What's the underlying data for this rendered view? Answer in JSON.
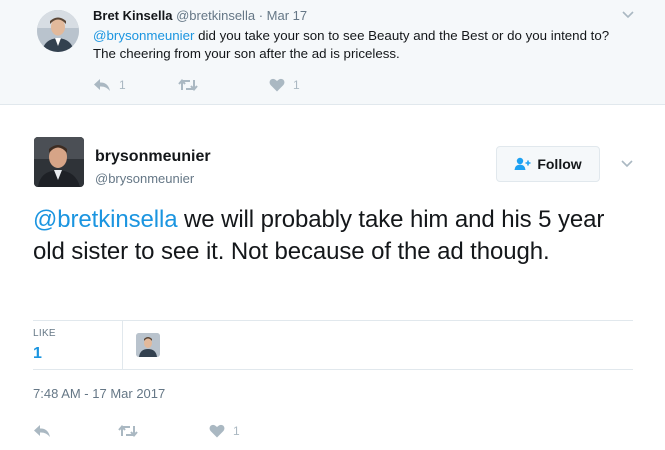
{
  "parent_tweet": {
    "author_name": "Bret Kinsella",
    "author_handle": "@bretkinsella",
    "separator": "·",
    "date": "Mar 17",
    "mention": "@brysonmeunier",
    "text": " did you take your son to see Beauty and the Best or do you intend to? The cheering from your son after the ad is priceless.",
    "reply_count": "1",
    "like_count": "1"
  },
  "main_tweet": {
    "author_name": "brysonmeunier",
    "author_handle": "@brysonmeunier",
    "follow_label": "Follow",
    "mention": "@bretkinsella",
    "text": " we will probably take him and his 5 year old sister to see it. Not because of the ad though.",
    "likes_label": "LIKE",
    "likes_value": "1",
    "timestamp": "7:48 AM - 17 Mar 2017",
    "like_count": "1"
  },
  "icons": [
    "reply-icon",
    "retweet-icon",
    "heart-icon",
    "chevron-down-icon",
    "follow-person-icon"
  ],
  "colors": {
    "link": "#1b95e0",
    "muted": "#657786",
    "icon": "#aab8c2",
    "parent_bg": "#f5f8fa"
  }
}
